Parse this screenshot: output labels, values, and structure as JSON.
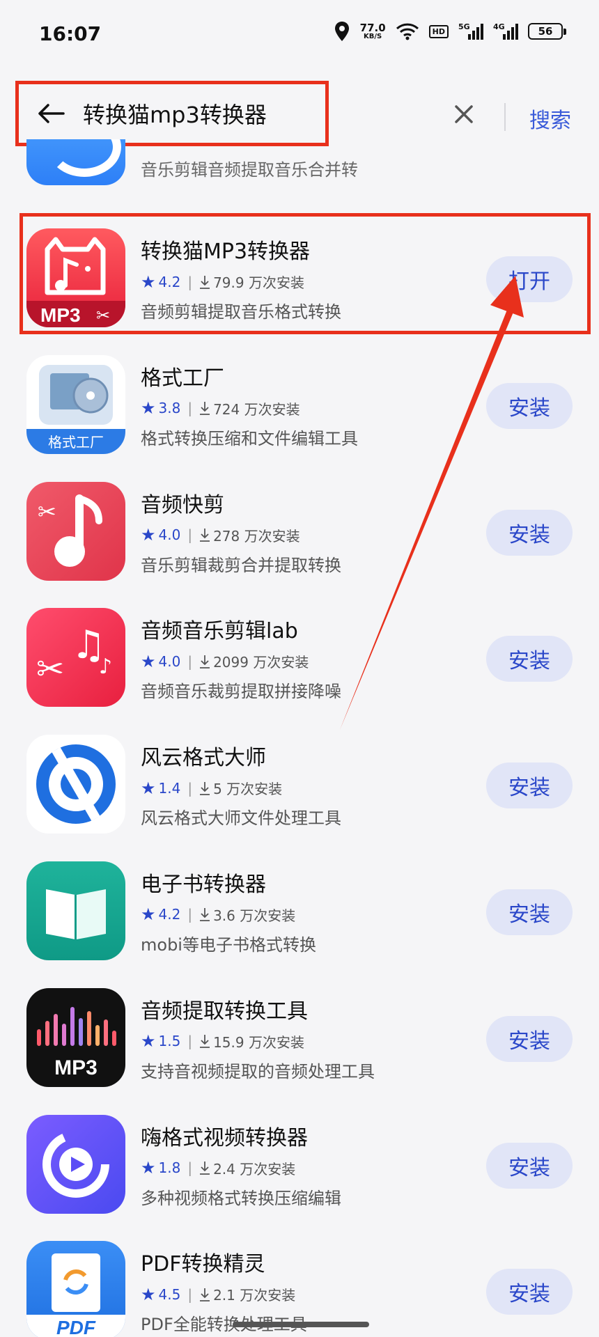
{
  "status_bar": {
    "time": "16:07",
    "net_speed_value": "77.0",
    "net_speed_unit": "KB/S",
    "hd_label": "HD",
    "sig1_label": "5G",
    "sig2_label": "4G",
    "battery": "56"
  },
  "search": {
    "query": "转换猫mp3转换器",
    "search_button": "搜索"
  },
  "partial_item": {
    "description": "音乐剪辑音频提取音乐合并转"
  },
  "apps": [
    {
      "name": "转换猫MP3转换器",
      "rating": "4.2",
      "downloads": "79.9 万次安装",
      "description": "音频剪辑提取音乐格式转换",
      "action": "打开",
      "icon_label": "MP3"
    },
    {
      "name": "格式工厂",
      "rating": "3.8",
      "downloads": "724 万次安装",
      "description": "格式转换压缩和文件编辑工具",
      "action": "安装",
      "icon_label": "格式工厂"
    },
    {
      "name": "音频快剪",
      "rating": "4.0",
      "downloads": "278 万次安装",
      "description": "音乐剪辑裁剪合并提取转换",
      "action": "安装",
      "icon_label": ""
    },
    {
      "name": "音频音乐剪辑lab",
      "rating": "4.0",
      "downloads": "2099 万次安装",
      "description": "音频音乐裁剪提取拼接降噪",
      "action": "安装",
      "icon_label": ""
    },
    {
      "name": "风云格式大师",
      "rating": "1.4",
      "downloads": "5 万次安装",
      "description": "风云格式大师文件处理工具",
      "action": "安装",
      "icon_label": ""
    },
    {
      "name": "电子书转换器",
      "rating": "4.2",
      "downloads": "3.6 万次安装",
      "description": "mobi等电子书格式转换",
      "action": "安装",
      "icon_label": ""
    },
    {
      "name": "音频提取转换工具",
      "rating": "1.5",
      "downloads": "15.9 万次安装",
      "description": "支持音视频提取的音频处理工具",
      "action": "安装",
      "icon_label": "MP3"
    },
    {
      "name": "嗨格式视频转换器",
      "rating": "1.8",
      "downloads": "2.4 万次安装",
      "description": "多种视频格式转换压缩编辑",
      "action": "安装",
      "icon_label": ""
    },
    {
      "name": "PDF转换精灵",
      "rating": "4.5",
      "downloads": "2.1 万次安装",
      "description": "PDF全能转换处理工具",
      "action": "安装",
      "icon_label": "PDF"
    }
  ],
  "colors": {
    "accent_blue": "#2a47c9",
    "button_bg": "#e1e5f7",
    "annotation_red": "#e8301c"
  }
}
